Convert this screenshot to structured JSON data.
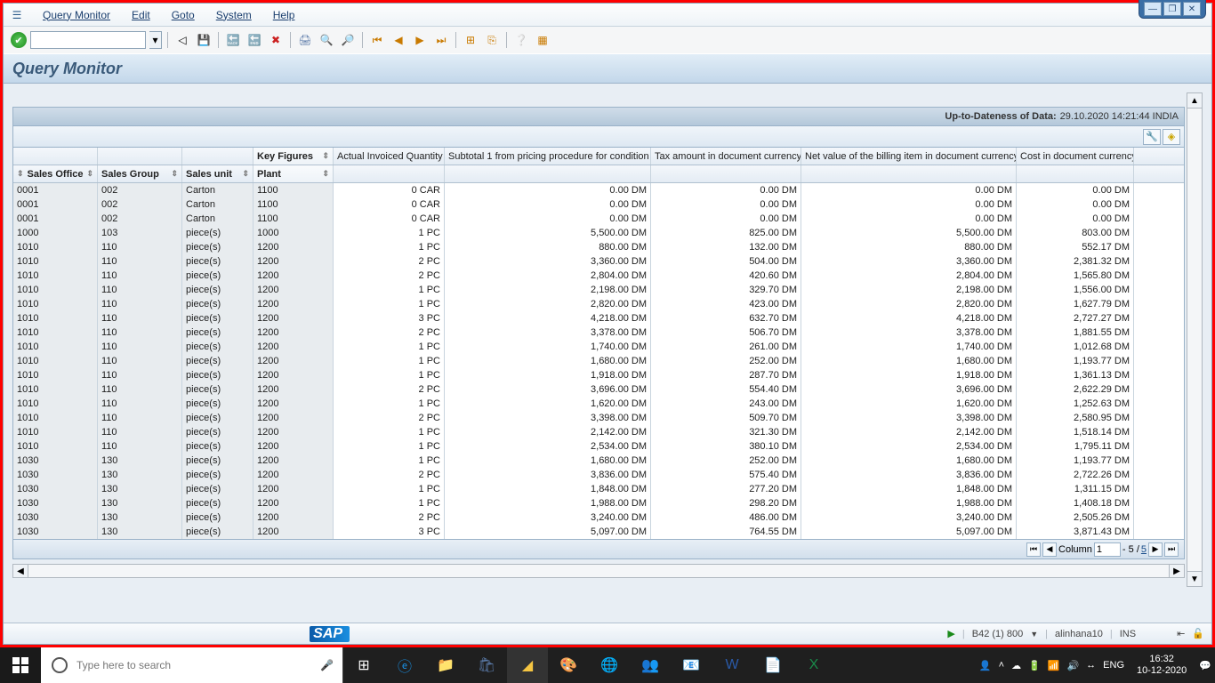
{
  "menu": {
    "items": [
      "Query Monitor",
      "Edit",
      "Goto",
      "System",
      "Help"
    ]
  },
  "page_title": "Query Monitor",
  "dateness": {
    "label": "Up-to-Dateness of Data:",
    "value": "29.10.2020 14:21:44 INDIA"
  },
  "key_figures_label": "Key Figures",
  "columns": {
    "sales_office": "Sales Office",
    "sales_group": "Sales Group",
    "sales_unit": "Sales unit",
    "plant": "Plant",
    "aiq": "Actual Invoiced Quantity",
    "sub1": "Subtotal 1 from pricing procedure for condition",
    "tax": "Tax amount in document currency",
    "net": "Net value of the billing item in document currency",
    "cost": "Cost in document currency"
  },
  "pagination": {
    "label": "Column",
    "value": "1",
    "range": "- 5 /",
    "total": "5"
  },
  "status": {
    "system": "B42 (1) 800",
    "user": "alinhana10",
    "ins": "INS"
  },
  "taskbar": {
    "search_placeholder": "Type here to search",
    "lang": "ENG",
    "time": "16:32",
    "date": "10-12-2020"
  },
  "rows": [
    {
      "so": "0001",
      "sg": "002",
      "su": "Carton",
      "pl": "1100",
      "aq": "0 CAR",
      "s1": "0.00 DM",
      "tx": "0.00 DM",
      "nv": "0.00 DM",
      "cc": "0.00 DM"
    },
    {
      "so": "0001",
      "sg": "002",
      "su": "Carton",
      "pl": "1100",
      "aq": "0 CAR",
      "s1": "0.00 DM",
      "tx": "0.00 DM",
      "nv": "0.00 DM",
      "cc": "0.00 DM"
    },
    {
      "so": "0001",
      "sg": "002",
      "su": "Carton",
      "pl": "1100",
      "aq": "0 CAR",
      "s1": "0.00 DM",
      "tx": "0.00 DM",
      "nv": "0.00 DM",
      "cc": "0.00 DM"
    },
    {
      "so": "1000",
      "sg": "103",
      "su": "piece(s)",
      "pl": "1000",
      "aq": "1 PC",
      "s1": "5,500.00 DM",
      "tx": "825.00 DM",
      "nv": "5,500.00 DM",
      "cc": "803.00 DM"
    },
    {
      "so": "1010",
      "sg": "110",
      "su": "piece(s)",
      "pl": "1200",
      "aq": "1 PC",
      "s1": "880.00 DM",
      "tx": "132.00 DM",
      "nv": "880.00 DM",
      "cc": "552.17 DM"
    },
    {
      "so": "1010",
      "sg": "110",
      "su": "piece(s)",
      "pl": "1200",
      "aq": "2 PC",
      "s1": "3,360.00 DM",
      "tx": "504.00 DM",
      "nv": "3,360.00 DM",
      "cc": "2,381.32 DM"
    },
    {
      "so": "1010",
      "sg": "110",
      "su": "piece(s)",
      "pl": "1200",
      "aq": "2 PC",
      "s1": "2,804.00 DM",
      "tx": "420.60 DM",
      "nv": "2,804.00 DM",
      "cc": "1,565.80 DM"
    },
    {
      "so": "1010",
      "sg": "110",
      "su": "piece(s)",
      "pl": "1200",
      "aq": "1 PC",
      "s1": "2,198.00 DM",
      "tx": "329.70 DM",
      "nv": "2,198.00 DM",
      "cc": "1,556.00 DM"
    },
    {
      "so": "1010",
      "sg": "110",
      "su": "piece(s)",
      "pl": "1200",
      "aq": "1 PC",
      "s1": "2,820.00 DM",
      "tx": "423.00 DM",
      "nv": "2,820.00 DM",
      "cc": "1,627.79 DM"
    },
    {
      "so": "1010",
      "sg": "110",
      "su": "piece(s)",
      "pl": "1200",
      "aq": "3 PC",
      "s1": "4,218.00 DM",
      "tx": "632.70 DM",
      "nv": "4,218.00 DM",
      "cc": "2,727.27 DM"
    },
    {
      "so": "1010",
      "sg": "110",
      "su": "piece(s)",
      "pl": "1200",
      "aq": "2 PC",
      "s1": "3,378.00 DM",
      "tx": "506.70 DM",
      "nv": "3,378.00 DM",
      "cc": "1,881.55 DM"
    },
    {
      "so": "1010",
      "sg": "110",
      "su": "piece(s)",
      "pl": "1200",
      "aq": "1 PC",
      "s1": "1,740.00 DM",
      "tx": "261.00 DM",
      "nv": "1,740.00 DM",
      "cc": "1,012.68 DM"
    },
    {
      "so": "1010",
      "sg": "110",
      "su": "piece(s)",
      "pl": "1200",
      "aq": "1 PC",
      "s1": "1,680.00 DM",
      "tx": "252.00 DM",
      "nv": "1,680.00 DM",
      "cc": "1,193.77 DM"
    },
    {
      "so": "1010",
      "sg": "110",
      "su": "piece(s)",
      "pl": "1200",
      "aq": "1 PC",
      "s1": "1,918.00 DM",
      "tx": "287.70 DM",
      "nv": "1,918.00 DM",
      "cc": "1,361.13 DM"
    },
    {
      "so": "1010",
      "sg": "110",
      "su": "piece(s)",
      "pl": "1200",
      "aq": "2 PC",
      "s1": "3,696.00 DM",
      "tx": "554.40 DM",
      "nv": "3,696.00 DM",
      "cc": "2,622.29 DM"
    },
    {
      "so": "1010",
      "sg": "110",
      "su": "piece(s)",
      "pl": "1200",
      "aq": "1 PC",
      "s1": "1,620.00 DM",
      "tx": "243.00 DM",
      "nv": "1,620.00 DM",
      "cc": "1,252.63 DM"
    },
    {
      "so": "1010",
      "sg": "110",
      "su": "piece(s)",
      "pl": "1200",
      "aq": "2 PC",
      "s1": "3,398.00 DM",
      "tx": "509.70 DM",
      "nv": "3,398.00 DM",
      "cc": "2,580.95 DM"
    },
    {
      "so": "1010",
      "sg": "110",
      "su": "piece(s)",
      "pl": "1200",
      "aq": "1 PC",
      "s1": "2,142.00 DM",
      "tx": "321.30 DM",
      "nv": "2,142.00 DM",
      "cc": "1,518.14 DM"
    },
    {
      "so": "1010",
      "sg": "110",
      "su": "piece(s)",
      "pl": "1200",
      "aq": "1 PC",
      "s1": "2,534.00 DM",
      "tx": "380.10 DM",
      "nv": "2,534.00 DM",
      "cc": "1,795.11 DM"
    },
    {
      "so": "1030",
      "sg": "130",
      "su": "piece(s)",
      "pl": "1200",
      "aq": "1 PC",
      "s1": "1,680.00 DM",
      "tx": "252.00 DM",
      "nv": "1,680.00 DM",
      "cc": "1,193.77 DM"
    },
    {
      "so": "1030",
      "sg": "130",
      "su": "piece(s)",
      "pl": "1200",
      "aq": "2 PC",
      "s1": "3,836.00 DM",
      "tx": "575.40 DM",
      "nv": "3,836.00 DM",
      "cc": "2,722.26 DM"
    },
    {
      "so": "1030",
      "sg": "130",
      "su": "piece(s)",
      "pl": "1200",
      "aq": "1 PC",
      "s1": "1,848.00 DM",
      "tx": "277.20 DM",
      "nv": "1,848.00 DM",
      "cc": "1,311.15 DM"
    },
    {
      "so": "1030",
      "sg": "130",
      "su": "piece(s)",
      "pl": "1200",
      "aq": "1 PC",
      "s1": "1,988.00 DM",
      "tx": "298.20 DM",
      "nv": "1,988.00 DM",
      "cc": "1,408.18 DM"
    },
    {
      "so": "1030",
      "sg": "130",
      "su": "piece(s)",
      "pl": "1200",
      "aq": "2 PC",
      "s1": "3,240.00 DM",
      "tx": "486.00 DM",
      "nv": "3,240.00 DM",
      "cc": "2,505.26 DM"
    },
    {
      "so": "1030",
      "sg": "130",
      "su": "piece(s)",
      "pl": "1200",
      "aq": "3 PC",
      "s1": "5,097.00 DM",
      "tx": "764.55 DM",
      "nv": "5,097.00 DM",
      "cc": "3,871.43 DM"
    }
  ]
}
